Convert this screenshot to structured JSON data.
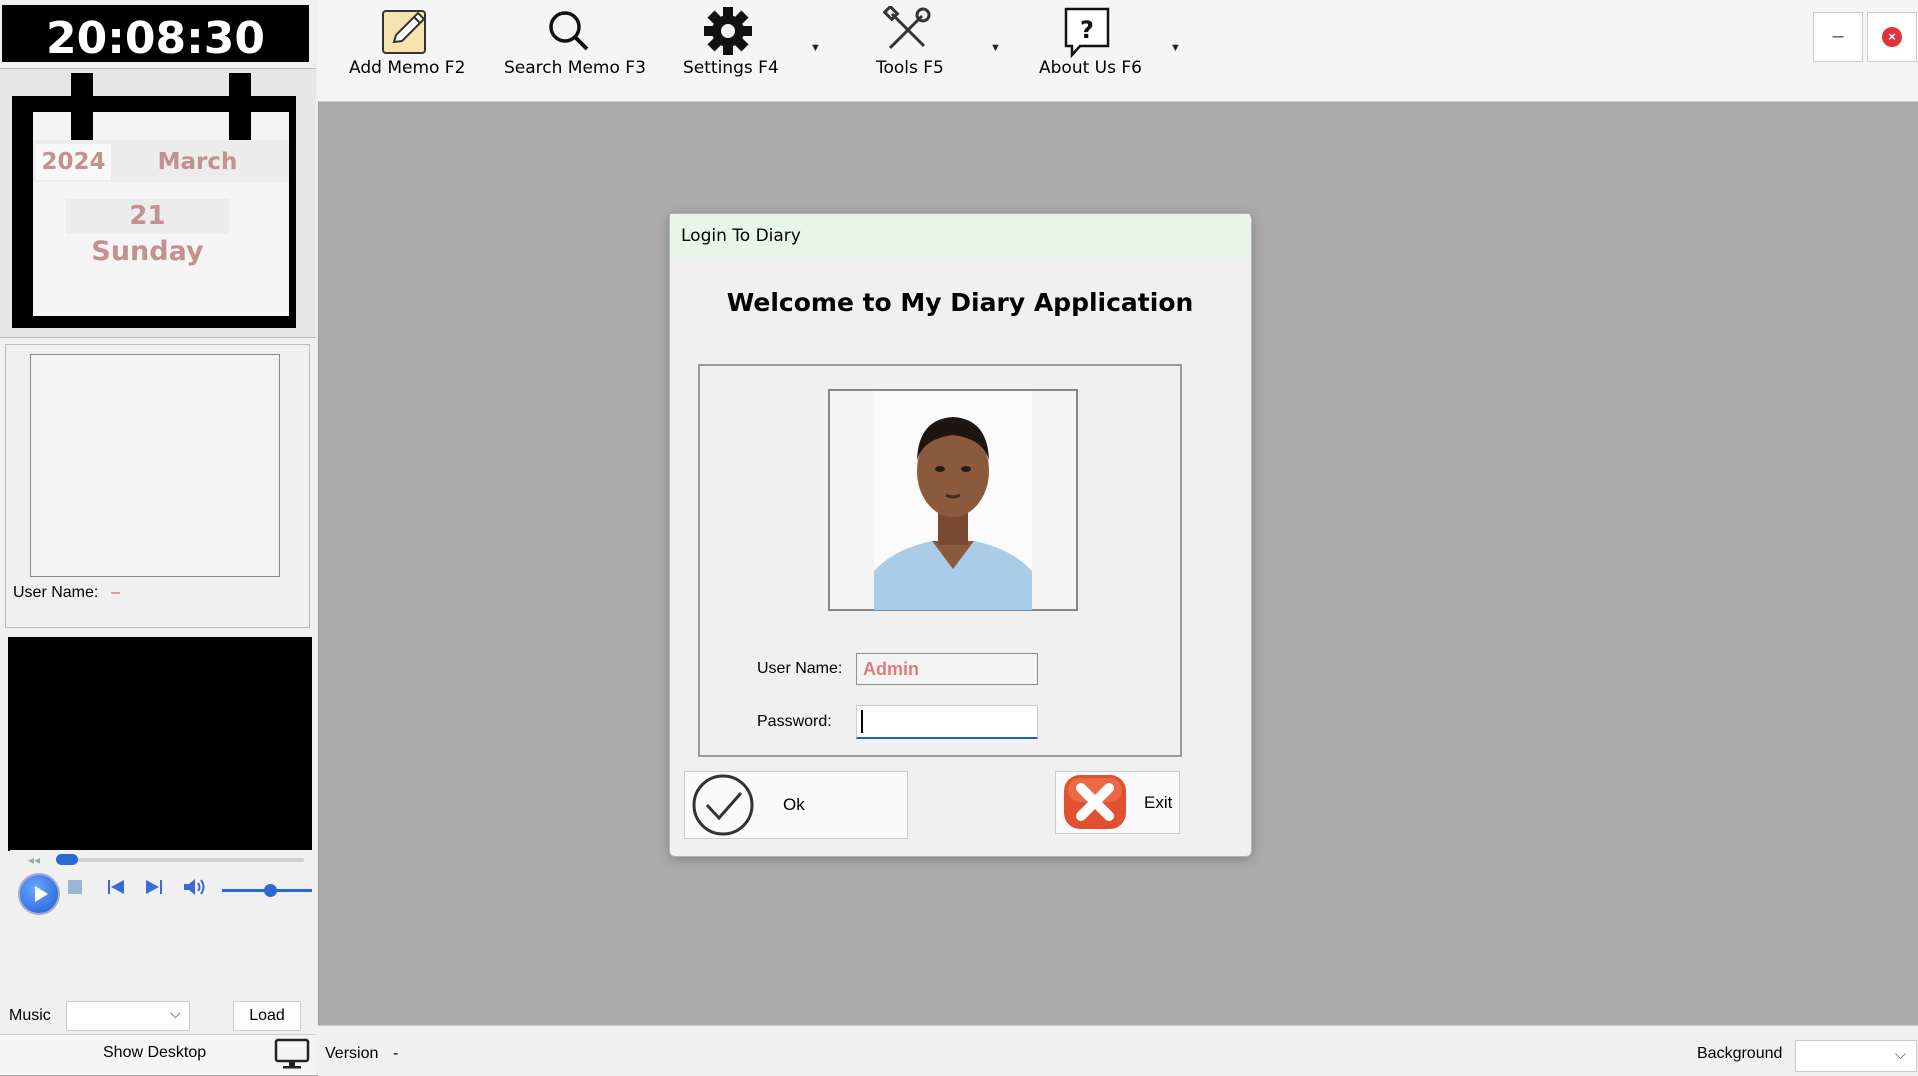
{
  "clock": {
    "time": "20:08:30"
  },
  "calendar": {
    "year": "2024",
    "month": "March",
    "day": "21",
    "weekday": "Sunday"
  },
  "user_panel": {
    "user_name_label": "User Name:",
    "user_name_value": "–"
  },
  "music": {
    "label": "Music",
    "selected": "",
    "load_label": "Load"
  },
  "show_desktop": {
    "label": "Show Desktop"
  },
  "toolbar": {
    "add_memo": "Add Memo F2",
    "search_memo": "Search Memo F3",
    "settings": "Settings F4",
    "tools": "Tools F5",
    "about": "About Us F6"
  },
  "window": {
    "minimize": "–",
    "close": "×"
  },
  "status": {
    "version_label": "Version",
    "version_value": "-",
    "background_label": "Background",
    "background_selected": ""
  },
  "dialog": {
    "title": "Login To Diary",
    "welcome": "Welcome to My Diary Application",
    "user_name_label": "User Name:",
    "user_name_value": "Admin",
    "password_label": "Password:",
    "password_value": "",
    "ok_label": "Ok",
    "exit_label": "Exit"
  },
  "colors": {
    "accent": "#1f5fcc",
    "calendar_text": "#c49090",
    "close_red": "#e3323b",
    "dialog_title_bg": "#e8f6e8",
    "workspace": "#ababab"
  },
  "icons": [
    "pencil-note-icon",
    "search-icon",
    "gear-icon",
    "tools-icon",
    "help-icon",
    "dropdown-arrow-icon",
    "play-icon",
    "stop-icon",
    "prev-icon",
    "next-icon",
    "volume-icon",
    "monitor-icon",
    "check-icon",
    "exit-x-icon"
  ]
}
